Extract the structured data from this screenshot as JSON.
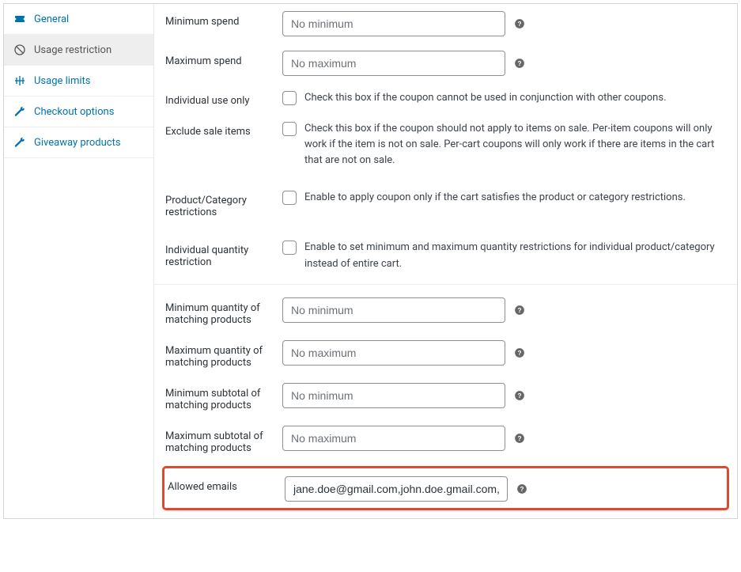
{
  "sidebar": {
    "items": [
      {
        "label": "General"
      },
      {
        "label": "Usage restriction"
      },
      {
        "label": "Usage limits"
      },
      {
        "label": "Checkout options"
      },
      {
        "label": "Giveaway products"
      }
    ]
  },
  "form": {
    "min_spend": {
      "label": "Minimum spend",
      "placeholder": "No minimum",
      "value": ""
    },
    "max_spend": {
      "label": "Maximum spend",
      "placeholder": "No maximum",
      "value": ""
    },
    "individual_use": {
      "label": "Individual use only",
      "desc": "Check this box if the coupon cannot be used in conjunction with other coupons."
    },
    "exclude_sale": {
      "label": "Exclude sale items",
      "desc": "Check this box if the coupon should not apply to items on sale. Per-item coupons will only work if the item is not on sale. Per-cart coupons will only work if there are items in the cart that are not on sale."
    },
    "prod_cat_restrictions": {
      "label": "Product/Category restrictions",
      "desc": "Enable to apply coupon only if the cart satisfies the product or category restrictions."
    },
    "indiv_qty_restriction": {
      "label": "Individual quantity restriction",
      "desc": "Enable to set minimum and maximum quantity restrictions for individual product/category instead of entire cart."
    },
    "min_qty": {
      "label": "Minimum quantity of matching products",
      "placeholder": "No minimum",
      "value": ""
    },
    "max_qty": {
      "label": "Maximum quantity of matching products",
      "placeholder": "No maximum",
      "value": ""
    },
    "min_subtotal": {
      "label": "Minimum subtotal of matching products",
      "placeholder": "No minimum",
      "value": ""
    },
    "max_subtotal": {
      "label": "Maximum subtotal of matching products",
      "placeholder": "No maximum",
      "value": ""
    },
    "allowed_emails": {
      "label": "Allowed emails",
      "value": "jane.doe@gmail.com,john.doe.gmail.com,"
    }
  }
}
